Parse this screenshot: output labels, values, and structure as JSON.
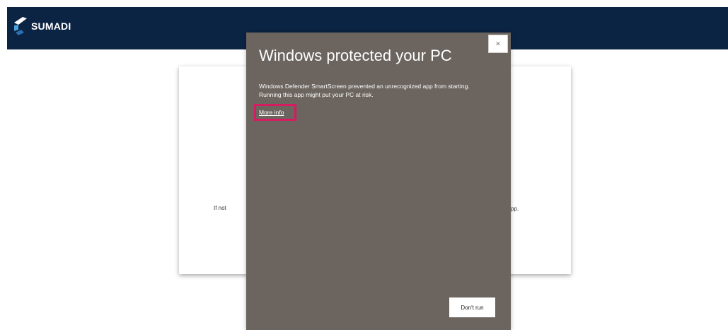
{
  "header": {
    "brand_name": "SUMADI",
    "brand_color": "#0c2444"
  },
  "background_page": {
    "left_text": "If not",
    "right_text": "pp."
  },
  "dialog": {
    "title": "Windows protected your PC",
    "message": "Windows Defender SmartScreen prevented an unrecognized app from starting. Running this app might put your PC at risk.",
    "more_info_label": "More info",
    "dont_run_label": "Don't run",
    "close_icon": "close-icon",
    "background_color": "#6b645f",
    "highlight_color": "#d81b60"
  }
}
